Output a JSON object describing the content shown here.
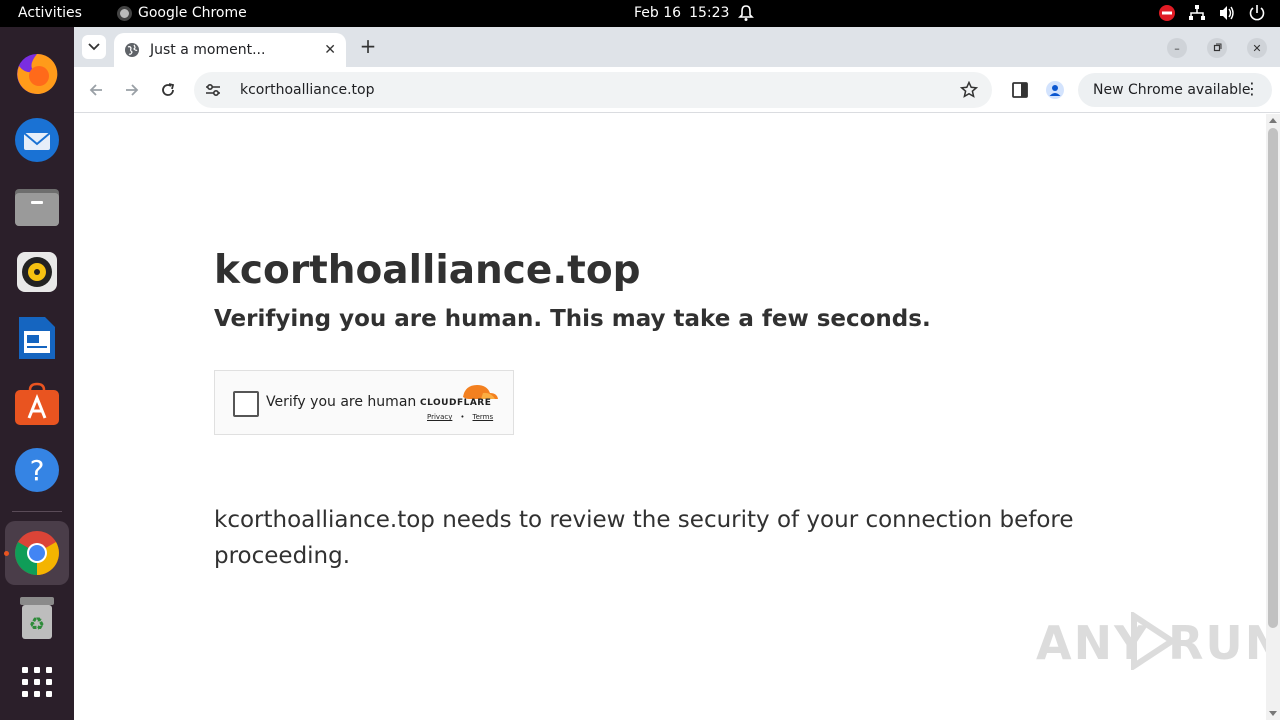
{
  "topbar": {
    "activities": "Activities",
    "app_name": "Google Chrome",
    "date": "Feb 16",
    "time": "15:23"
  },
  "dock": {
    "items": [
      "firefox-icon",
      "thunderbird-icon",
      "files-icon",
      "rhythmbox-icon",
      "writer-icon",
      "app-center-icon",
      "help-icon",
      "chrome-icon",
      "trash-icon",
      "app-grid-icon"
    ]
  },
  "browser": {
    "tab_title": "Just a moment...",
    "url": "kcorthoalliance.top",
    "update_label": "New Chrome available"
  },
  "page": {
    "heading": "kcorthoalliance.top",
    "subheading": "Verifying you are human. This may take a few seconds.",
    "checkbox_label": "Verify you are human",
    "cloudflare_word": "CLOUDFLARE",
    "privacy_link": "Privacy",
    "links_separator": "•",
    "terms_link": "Terms",
    "security_text": "kcorthoalliance.top needs to review the security of your connection before proceeding."
  },
  "watermark": {
    "left": "ANY",
    "right": "RUN"
  },
  "colors": {
    "dock_bg": "#2b1f2a",
    "cloudflare_orange": "#f38020",
    "ubuntu_orange": "#e95420"
  }
}
